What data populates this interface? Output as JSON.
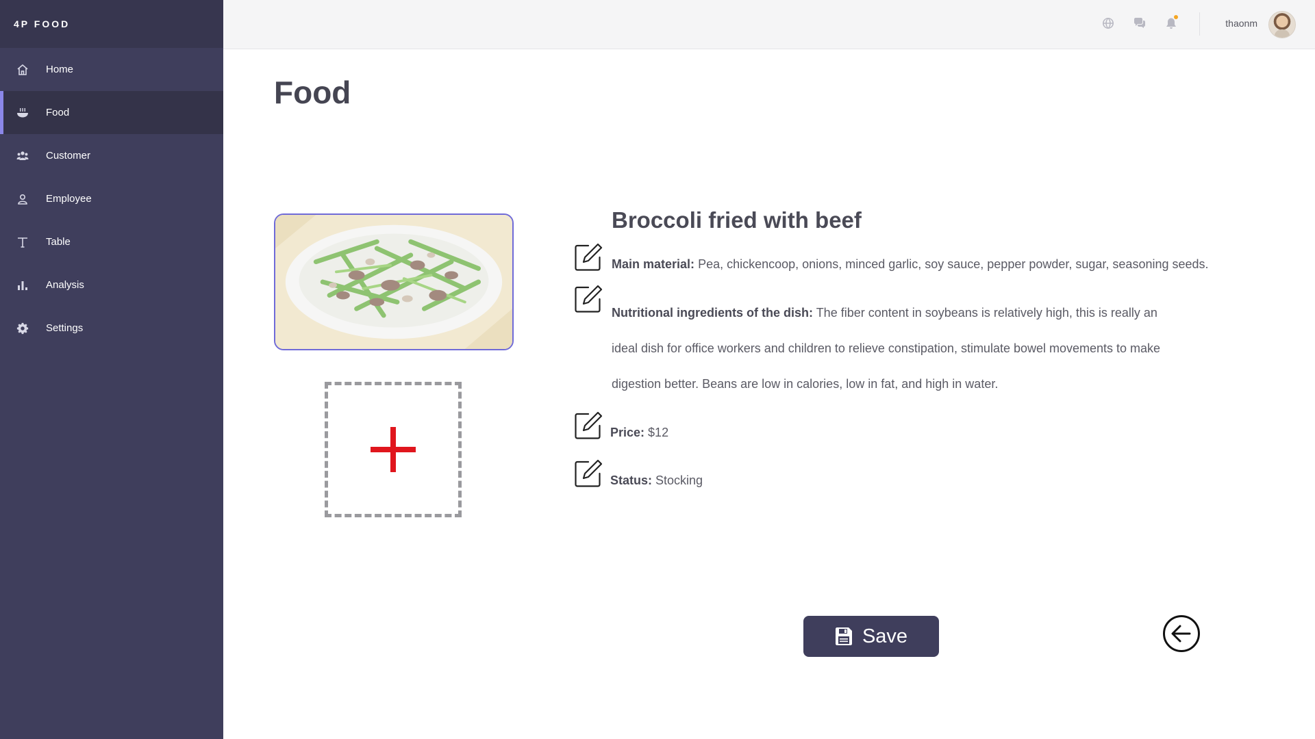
{
  "brand": {
    "name": "4P FOOD"
  },
  "sidebar": {
    "items": [
      {
        "label": "Home",
        "icon": "home-icon",
        "active": false
      },
      {
        "label": "Food",
        "icon": "bowl-icon",
        "active": true
      },
      {
        "label": "Customer",
        "icon": "users-icon",
        "active": false
      },
      {
        "label": "Employee",
        "icon": "user-icon",
        "active": false
      },
      {
        "label": "Table",
        "icon": "text-icon",
        "active": false
      },
      {
        "label": "Analysis",
        "icon": "bar-chart-icon",
        "active": false
      },
      {
        "label": "Settings",
        "icon": "gear-icon",
        "active": false
      }
    ]
  },
  "header": {
    "icons": [
      "globe-icon",
      "chat-icon",
      "bell-icon"
    ],
    "username": "thaonm"
  },
  "page": {
    "title": "Food"
  },
  "dish": {
    "name": "Broccoli fried with beef",
    "main_material_label": "Main material:",
    "main_material_value": "Pea, chickencoop, onions, minced garlic, soy sauce, pepper powder, sugar, seasoning seeds.",
    "nutrition_label": "Nutritional ingredients of the dish:",
    "nutrition_value": "The fiber content in soybeans is relatively high, this is really an ideal dish for office workers and children to relieve constipation, stimulate bowel movements to make digestion better. Beans are low in calories, low in fat, and high in water.",
    "price_label": "Price:",
    "price_value": "$12",
    "status_label": "Status:",
    "status_value": "Stocking"
  },
  "actions": {
    "save_label": "Save"
  },
  "colors": {
    "sidebar": "#3f3e5c",
    "accent": "#8b87e8",
    "upload_plus": "#e0161d",
    "notification": "#f5a623"
  }
}
